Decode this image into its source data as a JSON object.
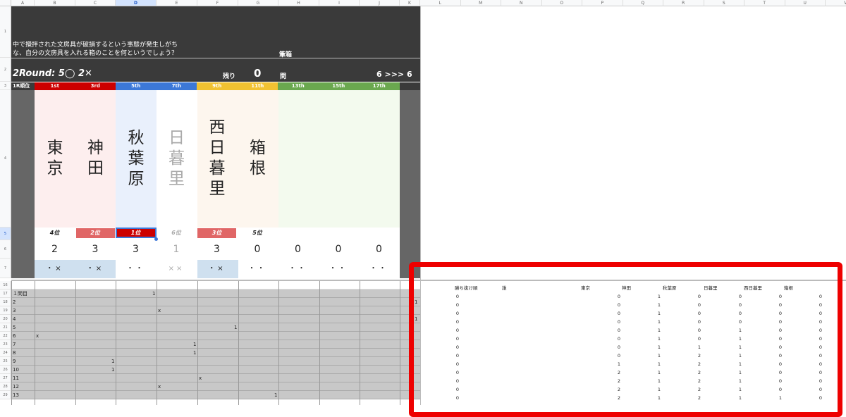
{
  "columns_left": [
    "A",
    "B",
    "C",
    "D",
    "E",
    "F",
    "G",
    "H",
    "I",
    "J",
    "K"
  ],
  "columns_right": [
    "L",
    "M",
    "N",
    "O",
    "P",
    "Q",
    "R",
    "S",
    "T",
    "U",
    "V"
  ],
  "question": {
    "line1": "中で攪拌された文房具が破損するという事態が発生しがち",
    "line2": "な、自分の文房具を入れる箱のことを何というでしょう？",
    "answer": "筆箱"
  },
  "status": {
    "round": "2Round: 5◯ 2✕",
    "remaining_label": "残り",
    "remaining_value": "0",
    "question_label": "問",
    "progress": "6 >>> 6"
  },
  "rank_header": "1R順位",
  "bands": [
    {
      "label": "1st",
      "color": "#cc0000"
    },
    {
      "label": "3rd",
      "color": "#cc0000"
    },
    {
      "label": "5th",
      "color": "#3c78d8"
    },
    {
      "label": "7th",
      "color": "#3c78d8"
    },
    {
      "label": "9th",
      "color": "#f1c232"
    },
    {
      "label": "11th",
      "color": "#f1c232"
    },
    {
      "label": "13th",
      "color": "#6aa84f"
    },
    {
      "label": "15th",
      "color": "#6aa84f"
    },
    {
      "label": "17th",
      "color": "#6aa84f"
    }
  ],
  "players": [
    {
      "name": "東京",
      "rank": "4位",
      "score": "2",
      "marks": "・×"
    },
    {
      "name": "神田",
      "rank": "2位",
      "score": "3",
      "marks": "・×"
    },
    {
      "name": "秋葉原",
      "rank": "1位",
      "score": "3",
      "marks": "・・"
    },
    {
      "name": "日暮里",
      "rank": "6位",
      "score": "1",
      "marks": "××"
    },
    {
      "name": "西日暮里",
      "rank": "3位",
      "score": "3",
      "marks": "・×"
    },
    {
      "name": "箱根",
      "rank": "5位",
      "score": "0",
      "marks": "・・"
    },
    {
      "name": "",
      "rank": "",
      "score": "0",
      "marks": "・・"
    },
    {
      "name": "",
      "rank": "",
      "score": "0",
      "marks": "・・"
    },
    {
      "name": "",
      "rank": "",
      "score": "0",
      "marks": "・・"
    }
  ],
  "row_numbers": [
    "1",
    "2",
    "3",
    "4",
    "5",
    "6",
    "7",
    "16",
    "17",
    "18",
    "19",
    "20",
    "21",
    "22",
    "23",
    "24",
    "25",
    "26",
    "27",
    "28",
    "29"
  ],
  "question_log": [
    {
      "label": "１問目",
      "mark": "1",
      "col": 2,
      "right": ""
    },
    {
      "label": "2",
      "mark": "",
      "col": -1,
      "right": "1"
    },
    {
      "label": "3",
      "mark": "x",
      "col": 3,
      "right": ""
    },
    {
      "label": "4",
      "mark": "",
      "col": -1,
      "right": "1"
    },
    {
      "label": "5",
      "mark": "1",
      "col": 4,
      "right": ""
    },
    {
      "label": "6",
      "mark": "x",
      "col": 0,
      "right": ""
    },
    {
      "label": "7",
      "mark": "1",
      "col": 3,
      "right": ""
    },
    {
      "label": "8",
      "mark": "1",
      "col": 3,
      "right": ""
    },
    {
      "label": "9",
      "mark": "1",
      "col": 1,
      "right": ""
    },
    {
      "label": "10",
      "mark": "1",
      "col": 1,
      "right": ""
    },
    {
      "label": "11",
      "mark": "x",
      "col": 4,
      "right": ""
    },
    {
      "label": "12",
      "mark": "x",
      "col": 3,
      "right": ""
    },
    {
      "label": "13",
      "mark": "1",
      "col": 5,
      "right": ""
    }
  ],
  "right_table": {
    "headers": [
      "勝ち抜け順",
      "誰",
      "東京",
      "神田",
      "秋葉原",
      "日暮里",
      "西日暮里",
      "箱根"
    ],
    "rows": [
      [
        "0",
        "",
        "0",
        "1",
        "0",
        "0",
        "0",
        "0"
      ],
      [
        "0",
        "",
        "0",
        "1",
        "0",
        "0",
        "0",
        "0"
      ],
      [
        "0",
        "",
        "0",
        "1",
        "0",
        "0",
        "0",
        "0"
      ],
      [
        "0",
        "",
        "0",
        "1",
        "0",
        "0",
        "0",
        "0"
      ],
      [
        "0",
        "",
        "0",
        "1",
        "0",
        "1",
        "0",
        "0"
      ],
      [
        "0",
        "",
        "0",
        "1",
        "0",
        "1",
        "0",
        "0"
      ],
      [
        "0",
        "",
        "0",
        "1",
        "1",
        "1",
        "0",
        "0"
      ],
      [
        "0",
        "",
        "0",
        "1",
        "2",
        "1",
        "0",
        "0"
      ],
      [
        "0",
        "",
        "1",
        "1",
        "2",
        "1",
        "0",
        "0"
      ],
      [
        "0",
        "",
        "2",
        "1",
        "2",
        "1",
        "0",
        "0"
      ],
      [
        "0",
        "",
        "2",
        "1",
        "2",
        "1",
        "0",
        "0"
      ],
      [
        "0",
        "",
        "2",
        "1",
        "2",
        "1",
        "0",
        "0"
      ],
      [
        "0",
        "",
        "2",
        "1",
        "2",
        "1",
        "1",
        "0"
      ]
    ]
  },
  "highlight_color": "#ee0000"
}
